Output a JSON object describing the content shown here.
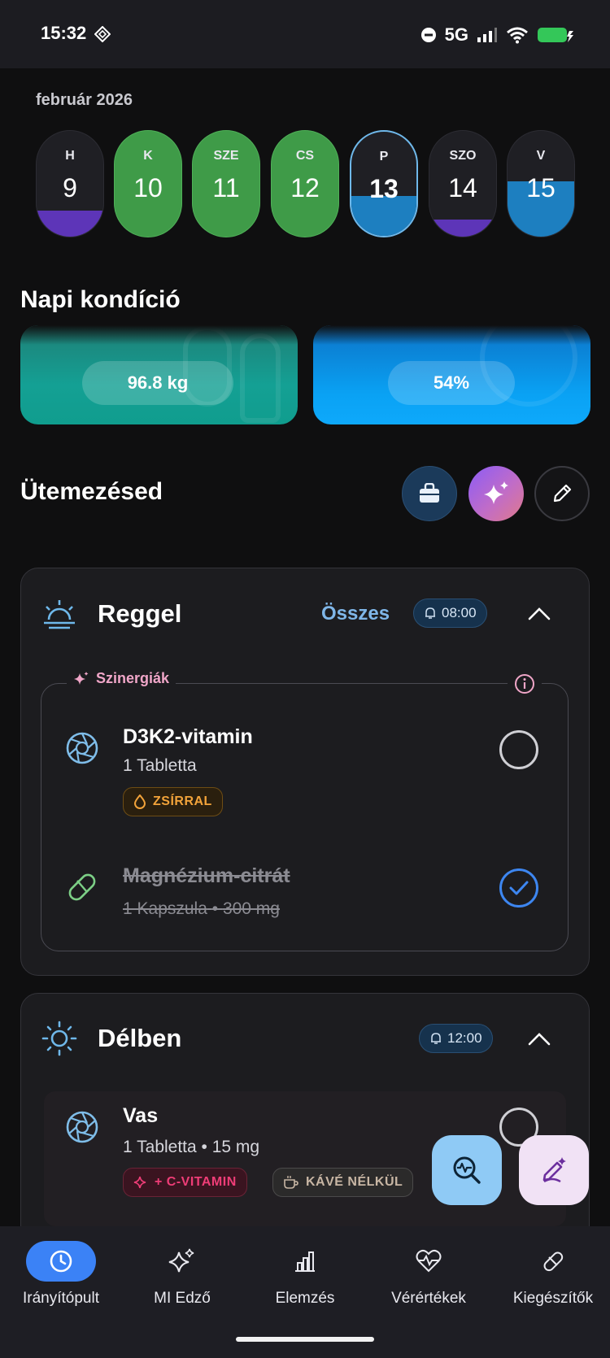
{
  "status_bar": {
    "time": "15:32",
    "network": "5G",
    "battery_color": "#34c759"
  },
  "calendar": {
    "month": "február 2026",
    "days": [
      {
        "letter": "H",
        "num": "9",
        "state": "purple",
        "fill": 0.25
      },
      {
        "letter": "K",
        "num": "10",
        "state": "green",
        "fill": 1.0
      },
      {
        "letter": "SZE",
        "num": "11",
        "state": "green",
        "fill": 1.0
      },
      {
        "letter": "CS",
        "num": "12",
        "state": "green",
        "fill": 1.0
      },
      {
        "letter": "P",
        "num": "13",
        "state": "blue",
        "fill": 0.38,
        "selected": true
      },
      {
        "letter": "SZO",
        "num": "14",
        "state": "purple",
        "fill": 0.16
      },
      {
        "letter": "V",
        "num": "15",
        "state": "blue",
        "fill": 0.52
      }
    ]
  },
  "condition": {
    "title": "Napi kondíció",
    "weight": "96.8 kg",
    "hydration": "54%"
  },
  "schedule": {
    "title": "Ütemezésed",
    "buttons": [
      "shopping-bag-icon",
      "sparkles-icon",
      "pencil-icon"
    ]
  },
  "morning": {
    "title": "Reggel",
    "all_label": "Összes",
    "time": "08:00",
    "synergy_label": "Szinergiák",
    "items": [
      {
        "name": "D3K2-vitamin",
        "sub": "1 Tabletta",
        "tag": "ZSÍRRAL",
        "done": false
      },
      {
        "name": "Magnézium-citrát",
        "sub_a": "1 Kapszula",
        "sub_b": "300 mg",
        "done": true
      }
    ]
  },
  "noon": {
    "title": "Délben",
    "time": "12:00",
    "items": [
      {
        "name": "Vas",
        "sub_a": "1 Tabletta",
        "sub_b": "15 mg",
        "tags": [
          "+ C-VITAMIN",
          "KÁVÉ NÉLKÜL"
        ],
        "done": false
      }
    ]
  },
  "nav": {
    "items": [
      {
        "label": "Irányítópult",
        "icon": "clock-icon",
        "active": true
      },
      {
        "label": "MI Edző",
        "icon": "sparkles-icon"
      },
      {
        "label": "Elemzés",
        "icon": "bar-chart-icon"
      },
      {
        "label": "Vérértékek",
        "icon": "heart-pulse-icon"
      },
      {
        "label": "Kiegészítők",
        "icon": "pill-icon"
      }
    ]
  },
  "colors": {
    "green": "#3f9b48",
    "blue": "#1d7fc0",
    "purple": "#5d35b8",
    "accent": "#3b82f6"
  }
}
